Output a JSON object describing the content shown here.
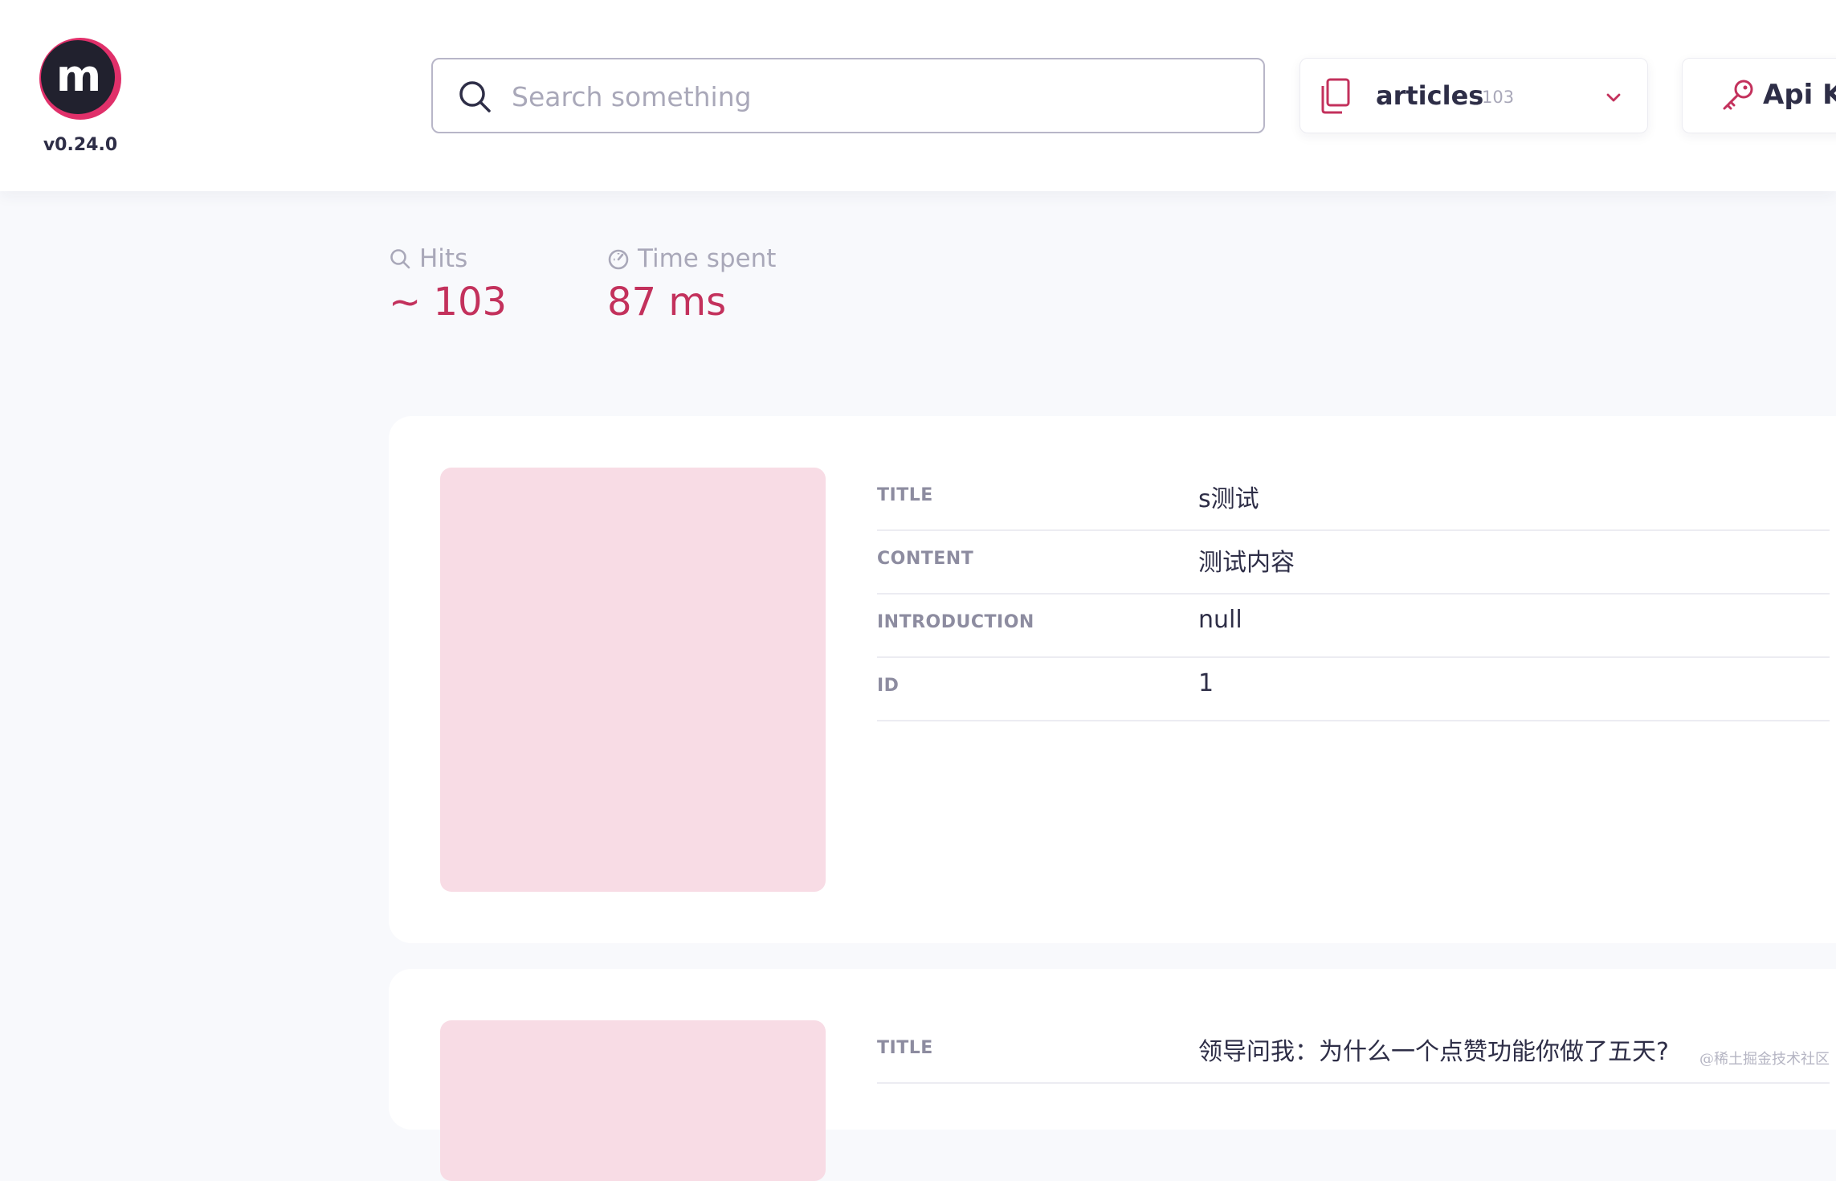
{
  "app": {
    "version": "v0.24.0",
    "accent_color": "#c3315c"
  },
  "search": {
    "placeholder": "Search something",
    "value": ""
  },
  "index_selector": {
    "name": "articles",
    "count": "103",
    "icon": "documents-icon"
  },
  "api_keys": {
    "label": "Api Ke"
  },
  "stats": {
    "hits_label": "Hits",
    "hits_value": "~ 103",
    "time_label": "Time spent",
    "time_value": "87 ms"
  },
  "results": [
    {
      "fields": [
        {
          "key": "TITLE",
          "value": "s测试"
        },
        {
          "key": "CONTENT",
          "value": "测试内容"
        },
        {
          "key": "INTRODUCTION",
          "value": "null"
        },
        {
          "key": "ID",
          "value": "1"
        }
      ]
    },
    {
      "fields": [
        {
          "key": "TITLE",
          "value": "领导问我：为什么一个点赞功能你做了五天?"
        }
      ]
    }
  ],
  "watermark": "@稀土掘金技术社区"
}
